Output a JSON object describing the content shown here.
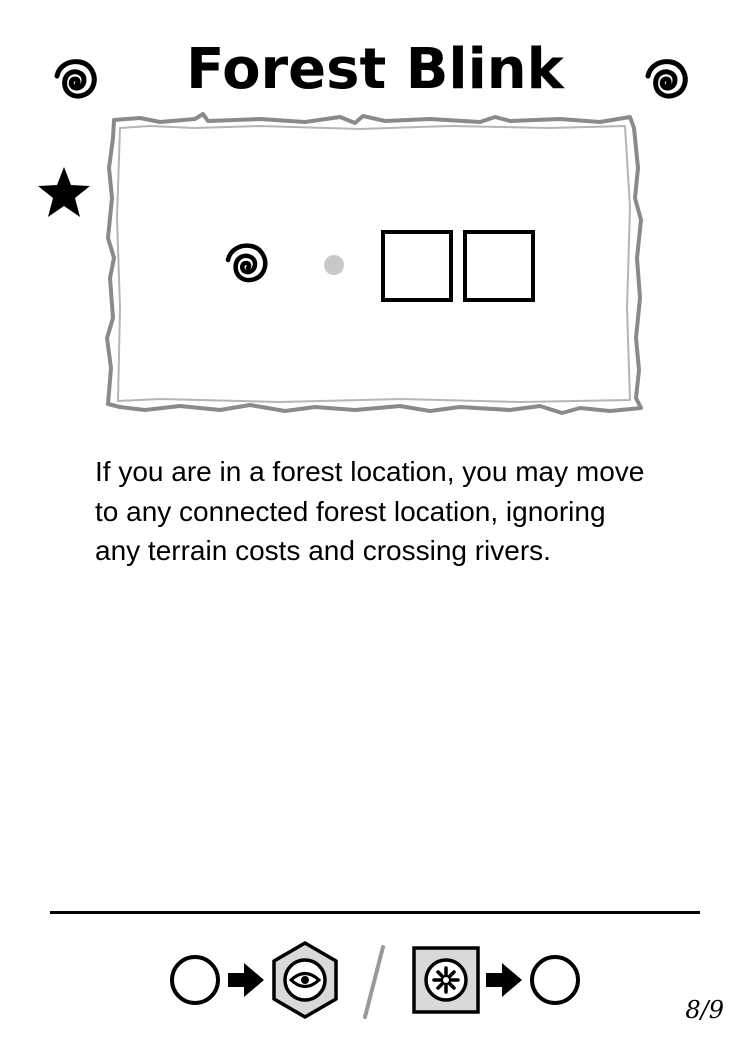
{
  "card": {
    "title": "Forest Blink",
    "rules_text": "If you are in a forest location, you may move to any connected forest location, ignoring any terrain costs and crossing rivers.",
    "page_number": "8/9"
  },
  "icons": {
    "title_left": "spiral-icon",
    "title_right": "spiral-icon",
    "card_type": "star-icon",
    "cost": "spiral-icon",
    "separator_dot": "dot-icon",
    "empty_slots": 2,
    "footer": [
      "circle-icon",
      "arrow-right-icon",
      "hex-eye-icon",
      "slash-divider",
      "square-compass-icon",
      "arrow-right-icon",
      "circle-icon"
    ]
  },
  "colors": {
    "ink": "#000000",
    "parchment_border": "#8a8a8a",
    "dot": "#c8c8c8",
    "token_fill": "#d9d9d9"
  }
}
